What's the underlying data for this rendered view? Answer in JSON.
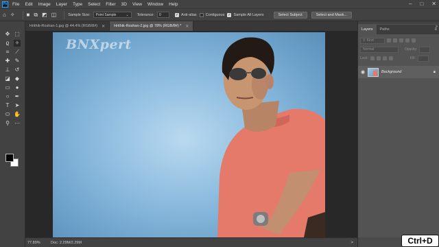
{
  "menubar": {
    "logo": "Ps",
    "items": [
      "File",
      "Edit",
      "Image",
      "Layer",
      "Type",
      "Select",
      "Filter",
      "3D",
      "View",
      "Window",
      "Help"
    ],
    "window_controls": [
      "–",
      "□",
      "✕"
    ]
  },
  "options": {
    "sample_size_label": "Sample Size:",
    "sample_size_value": "Point Sample",
    "tolerance_label": "Tolerance:",
    "tolerance_value": "0",
    "antialias_label": "Anti-alias",
    "antialias_checked": true,
    "contiguous_label": "Contiguous",
    "contiguous_checked": false,
    "sample_all_layers_label": "Sample All Layers",
    "sample_all_layers_checked": true,
    "select_subject_label": "Select Subject",
    "select_and_mask_label": "Select and Mask..."
  },
  "tabs": [
    {
      "label": "Hrithik-Roshan-1.jpg @ 44.4% (RGB/8#)",
      "active": false
    },
    {
      "label": "Hrithik-Roshan-2.jpg @ 78% (RGB/8#) *",
      "active": true
    }
  ],
  "canvas": {
    "watermark": "BNXpert",
    "background_color": "#8fbde0"
  },
  "status": {
    "zoom": "77.89%",
    "doc": "Doc: 2.29M/2.29M",
    "arrow": ">"
  },
  "layers_panel": {
    "tabs": [
      "Layers",
      "Paths"
    ],
    "kind_placeholder": "Kind",
    "blend_mode": "Normal",
    "opacity_label": "Opacity:",
    "lock_label": "Lock:",
    "fill_label": "Fill:",
    "layer_name": "Background"
  },
  "shortcut_badge": "Ctrl+D",
  "colors": {
    "accent": "#31a8ff",
    "panel": "#424242",
    "workspace": "#535353"
  }
}
